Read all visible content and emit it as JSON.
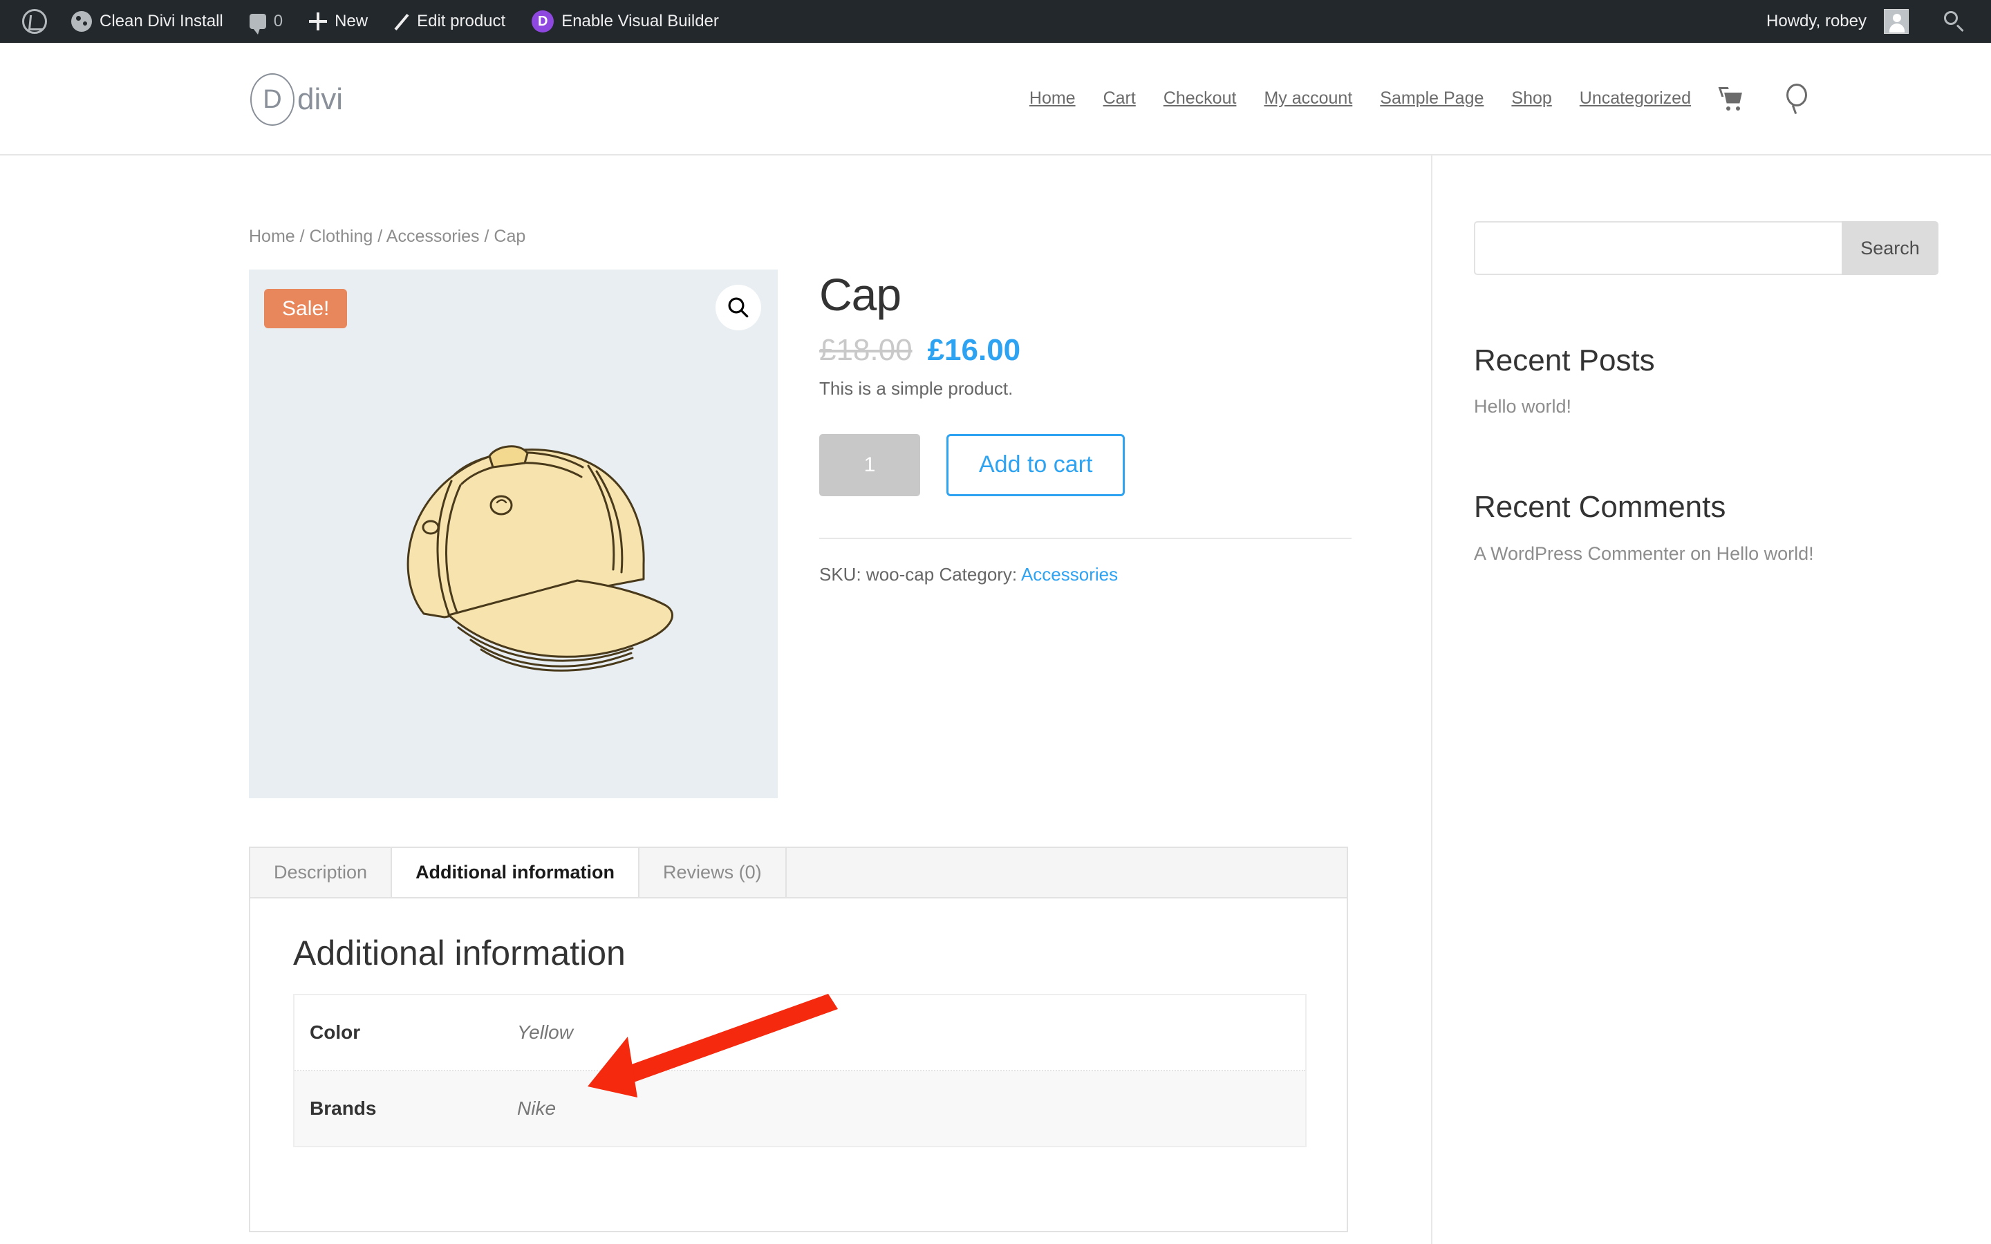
{
  "adminbar": {
    "wp_logo_label": "WordPress",
    "site_name": "Clean Divi Install",
    "comment_count": "0",
    "new_label": "New",
    "edit_label": "Edit product",
    "divi_badge": "D",
    "visual_builder_label": "Enable Visual Builder",
    "howdy": "Howdy, robey",
    "search_label": "Search",
    "bg_color": "#23282d",
    "divi_purple": "#8e47df"
  },
  "header": {
    "logo_letter": "D",
    "logo_word": "divi",
    "nav": [
      {
        "label": "Home"
      },
      {
        "label": "Cart"
      },
      {
        "label": "Checkout"
      },
      {
        "label": "My account"
      },
      {
        "label": "Sample Page"
      },
      {
        "label": "Shop"
      },
      {
        "label": "Uncategorized"
      }
    ],
    "cart_icon": "cart-icon",
    "search_icon": "search-icon"
  },
  "breadcrumb": {
    "items": [
      "Home",
      "Clothing",
      "Accessories",
      "Cap"
    ],
    "separator": "/"
  },
  "gallery": {
    "sale_badge": "Sale!",
    "zoom_icon": "magnifier-icon",
    "image_alt": "Yellow baseball cap illustration",
    "bg_color": "#e9eef2"
  },
  "product": {
    "title": "Cap",
    "price_regular": "£18.00",
    "price_sale": "£16.00",
    "short_description": "This is a simple product.",
    "quantity": "1",
    "add_to_cart": "Add to cart",
    "sku_label": "SKU:",
    "sku_value": "woo-cap",
    "category_label": "Category:",
    "category_value": "Accessories",
    "accent_color": "#2ea3f2",
    "sale_color": "#e8875c"
  },
  "tabs": {
    "items": [
      {
        "label": "Description",
        "active": false
      },
      {
        "label": "Additional information",
        "active": true
      },
      {
        "label": "Reviews (0)",
        "active": false
      }
    ],
    "panel_heading": "Additional information",
    "attributes": [
      {
        "name": "Color",
        "value": "Yellow"
      },
      {
        "name": "Brands",
        "value": "Nike"
      }
    ]
  },
  "sidebar": {
    "search": {
      "value": "",
      "placeholder": "",
      "button_label": "Search"
    },
    "recent_posts": {
      "title": "Recent Posts",
      "items": [
        "Hello world!"
      ]
    },
    "recent_comments": {
      "title": "Recent Comments",
      "items": [
        "A WordPress Commenter on Hello world!"
      ]
    }
  },
  "annotation": {
    "arrow_color": "#f4290d",
    "points_at": "Brands"
  }
}
